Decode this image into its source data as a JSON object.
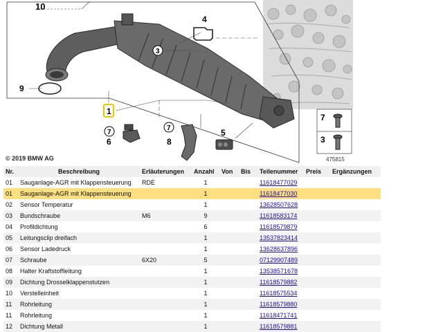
{
  "diagram": {
    "copyright": "© 2019 BMW AG",
    "image_number": "475815",
    "callouts": [
      "10",
      "4",
      "3",
      "9",
      "1",
      "7",
      "6",
      "8",
      "5"
    ],
    "inset_callouts": [
      "7",
      "3"
    ],
    "highlight_color": "#f5c400"
  },
  "table": {
    "headers": {
      "nr": "Nr.",
      "beschreibung": "Beschreibung",
      "erlaeuterungen": "Erläuterungen",
      "anzahl": "Anzahl",
      "von": "Von",
      "bis": "Bis",
      "teilenummer": "Teilenummer",
      "preis": "Preis",
      "ergaenzungen": "Ergänzungen"
    },
    "rows": [
      {
        "nr": "01",
        "beschreibung": "Sauganlage-AGR mit Klappensteuerung",
        "erlaeuterungen": "RDE",
        "anzahl": "1",
        "teilenummer": "11618477029"
      },
      {
        "nr": "01",
        "beschreibung": "Sauganlage-AGR mit Klappensteuerung",
        "erlaeuterungen": "",
        "anzahl": "1",
        "teilenummer": "11618477030"
      },
      {
        "nr": "02",
        "beschreibung": "Sensor Temperatur",
        "erlaeuterungen": "",
        "anzahl": "1",
        "teilenummer": "13628507628"
      },
      {
        "nr": "03",
        "beschreibung": "Bundschraube",
        "erlaeuterungen": "M6",
        "anzahl": "9",
        "teilenummer": "11618583174"
      },
      {
        "nr": "04",
        "beschreibung": "Profildichtung",
        "erlaeuterungen": "",
        "anzahl": "6",
        "teilenummer": "11618579879"
      },
      {
        "nr": "05",
        "beschreibung": "Leitungsclip dreifach",
        "erlaeuterungen": "",
        "anzahl": "1",
        "teilenummer": "13537823414"
      },
      {
        "nr": "06",
        "beschreibung": "Sensor Ladedruck",
        "erlaeuterungen": "",
        "anzahl": "1",
        "teilenummer": "13628637896"
      },
      {
        "nr": "07",
        "beschreibung": "Schraube",
        "erlaeuterungen": "6X20",
        "anzahl": "5",
        "teilenummer": "07129907489"
      },
      {
        "nr": "08",
        "beschreibung": "Halter Kraftstoffleitung",
        "erlaeuterungen": "",
        "anzahl": "1",
        "teilenummer": "13538571678"
      },
      {
        "nr": "09",
        "beschreibung": "Dichtung Drosselklappenstutzen",
        "erlaeuterungen": "",
        "anzahl": "1",
        "teilenummer": "11618579882"
      },
      {
        "nr": "10",
        "beschreibung": "Verstelleinheit",
        "erlaeuterungen": "",
        "anzahl": "1",
        "teilenummer": "11618575534"
      },
      {
        "nr": "11",
        "beschreibung": "Rohrleitung",
        "erlaeuterungen": "",
        "anzahl": "1",
        "teilenummer": "11618579880"
      },
      {
        "nr": "11",
        "beschreibung": "Rohrleitung",
        "erlaeuterungen": "",
        "anzahl": "1",
        "teilenummer": "11618471741"
      },
      {
        "nr": "12",
        "beschreibung": "Dichtung Metall",
        "erlaeuterungen": "",
        "anzahl": "1",
        "teilenummer": "11618579881"
      }
    ],
    "highlighted_row": 1
  }
}
